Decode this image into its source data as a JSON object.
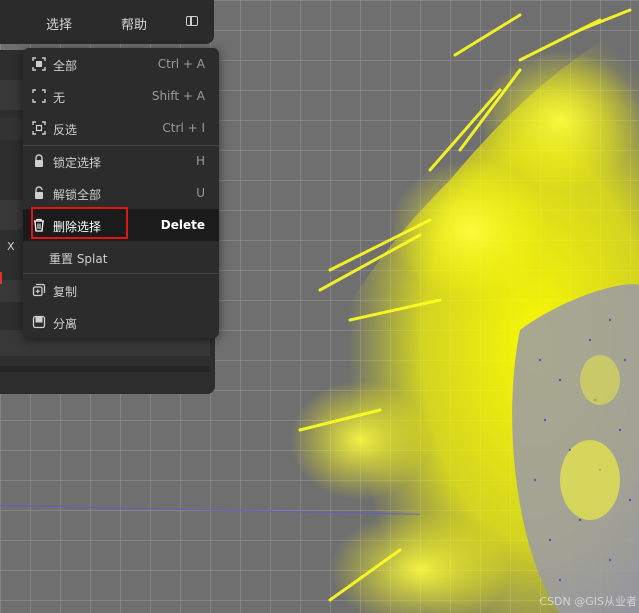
{
  "menubar": {
    "select_label": "选择",
    "help_label": "帮助",
    "panel_toggle_icon": "panel-toggle-icon"
  },
  "side_panel": {
    "axis_label": "X"
  },
  "context_menu": {
    "items": [
      {
        "label": "全部",
        "shortcut": "Ctrl + A",
        "icon": "select-all-icon"
      },
      {
        "label": "无",
        "shortcut": "Shift + A",
        "icon": "select-none-icon"
      },
      {
        "label": "反选",
        "shortcut": "Ctrl + I",
        "icon": "invert-selection-icon"
      },
      {
        "label": "锁定选择",
        "shortcut": "H",
        "icon": "lock-icon"
      },
      {
        "label": "解锁全部",
        "shortcut": "U",
        "icon": "unlock-icon"
      },
      {
        "label": "删除选择",
        "shortcut": "Delete",
        "icon": "trash-icon",
        "active": true
      },
      {
        "label": "重置 Splat",
        "shortcut": "",
        "icon": ""
      },
      {
        "label": "复制",
        "shortcut": "",
        "icon": "duplicate-icon"
      },
      {
        "label": "分离",
        "shortcut": "",
        "icon": "separate-icon"
      }
    ]
  },
  "colors": {
    "splat_yellow": "#ffff00",
    "splat_blue": "#4a4ad0",
    "highlight_red": "#e01515",
    "menu_bg": "#2c2c2c",
    "viewport_bg": "#6f6f6f"
  },
  "watermark": "CSDN @GIS从业者"
}
